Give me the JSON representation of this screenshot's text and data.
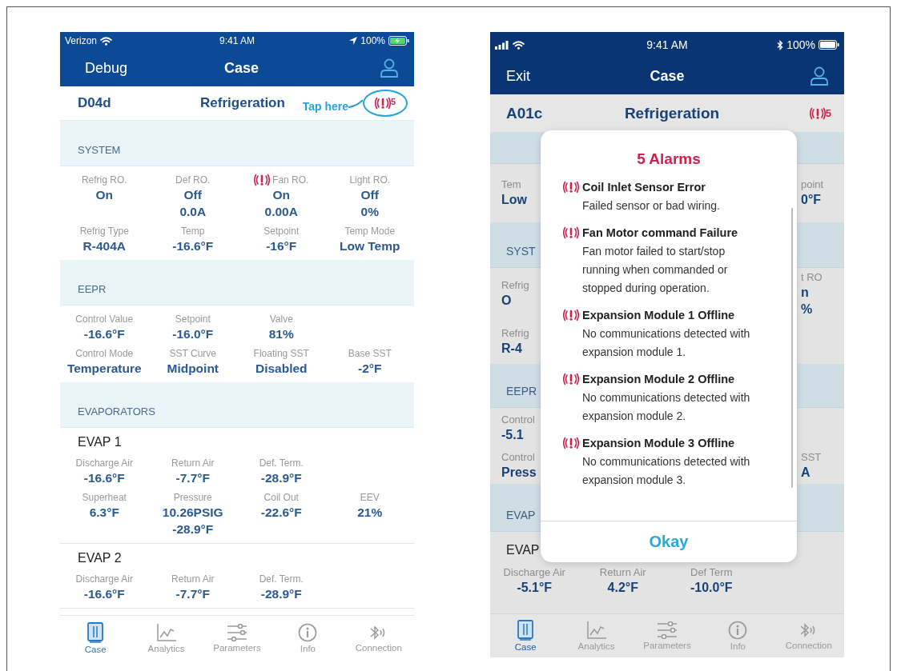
{
  "left_screen": {
    "status_bar": {
      "carrier": "Verizon",
      "time": "9:41 AM",
      "kind": "location",
      "battery": "100%",
      "charging": true
    },
    "nav": {
      "left": "Debug",
      "title": "Case"
    },
    "case_bar": {
      "id": "D04d",
      "title": "Refrigeration",
      "callout": "Tap here",
      "alarm_count": "5"
    },
    "sections": [
      {
        "title": "SYSTEM",
        "groups": [
          {
            "rows": [
              [
                {
                  "label": "Refrig RO.",
                  "values": [
                    "On"
                  ],
                  "alarm": false
                },
                {
                  "label": "Def RO.",
                  "values": [
                    "Off",
                    "0.0A"
                  ],
                  "alarm": false
                },
                {
                  "label": "Fan RO.",
                  "values": [
                    "On",
                    "0.00A"
                  ],
                  "alarm": true
                },
                {
                  "label": "Light RO.",
                  "values": [
                    "Off",
                    "0%"
                  ],
                  "alarm": false
                }
              ],
              [
                {
                  "label": "Refrig Type",
                  "values": [
                    "R-404A"
                  ],
                  "alarm": false
                },
                {
                  "label": "Temp",
                  "values": [
                    "-16.6°F"
                  ],
                  "alarm": false
                },
                {
                  "label": "Setpoint",
                  "values": [
                    "-16°F"
                  ],
                  "alarm": false
                },
                {
                  "label": "Temp Mode",
                  "values": [
                    "Low Temp"
                  ],
                  "alarm": false
                }
              ]
            ]
          }
        ]
      },
      {
        "title": "EEPR",
        "groups": [
          {
            "rows": [
              [
                {
                  "label": "Control Value",
                  "values": [
                    "-16.6°F"
                  ],
                  "alarm": false
                },
                {
                  "label": "Setpoint",
                  "values": [
                    "-16.0°F"
                  ],
                  "alarm": false
                },
                {
                  "label": "Valve",
                  "values": [
                    "81%"
                  ],
                  "alarm": false
                }
              ],
              [
                {
                  "label": "Control Mode",
                  "values": [
                    "Temperature"
                  ],
                  "alarm": false
                },
                {
                  "label": "SST Curve",
                  "values": [
                    "Midpoint"
                  ],
                  "alarm": false
                },
                {
                  "label": "Floating SST",
                  "values": [
                    "Disabled"
                  ],
                  "alarm": false
                },
                {
                  "label": "Base SST",
                  "values": [
                    "-2°F"
                  ],
                  "alarm": false
                }
              ]
            ]
          }
        ]
      },
      {
        "title": "EVAPORATORS",
        "groups": [
          {
            "name": "EVAP 1",
            "rows": [
              [
                {
                  "label": "Discharge Air",
                  "values": [
                    "-16.6°F"
                  ],
                  "alarm": false
                },
                {
                  "label": "Return Air",
                  "values": [
                    "-7.7°F"
                  ],
                  "alarm": false
                },
                {
                  "label": "Def. Term.",
                  "values": [
                    "-28.9°F"
                  ],
                  "alarm": false
                }
              ],
              [
                {
                  "label": "Superheat",
                  "values": [
                    "6.3°F"
                  ],
                  "alarm": false
                },
                {
                  "label": "Pressure",
                  "values": [
                    "10.26PSIG",
                    "-28.9°F"
                  ],
                  "alarm": false
                },
                {
                  "label": "Coil Out",
                  "values": [
                    "-22.6°F"
                  ],
                  "alarm": false
                },
                {
                  "label": "EEV",
                  "values": [
                    "21%"
                  ],
                  "alarm": false
                }
              ]
            ]
          },
          {
            "name": "EVAP 2",
            "rows": [
              [
                {
                  "label": "Discharge Air",
                  "values": [
                    "-16.6°F"
                  ],
                  "alarm": false
                },
                {
                  "label": "Return Air",
                  "values": [
                    "-7.7°F"
                  ],
                  "alarm": false
                },
                {
                  "label": "Def. Term.",
                  "values": [
                    "-28.9°F"
                  ],
                  "alarm": false
                }
              ]
            ]
          }
        ]
      }
    ],
    "tabs": [
      {
        "label": "Case",
        "kind": "case",
        "selected": true
      },
      {
        "label": "Analytics",
        "kind": "analytics",
        "selected": false
      },
      {
        "label": "Parameters",
        "kind": "parameters",
        "selected": false
      },
      {
        "label": "Info",
        "kind": "info",
        "selected": false
      },
      {
        "label": "Connection",
        "kind": "connection",
        "selected": false
      }
    ]
  },
  "right_screen": {
    "status_bar": {
      "time": "9:41 AM",
      "kind": "bluetooth",
      "battery": "100%",
      "charging": false
    },
    "nav": {
      "left": "Exit",
      "title": "Case"
    },
    "case_bar": {
      "id": "A01c",
      "title": "Refrigeration",
      "alarm_count": "5"
    },
    "background_rows": [
      {
        "kind": "section"
      },
      {
        "kind": "field",
        "left": {
          "label": "Tem",
          "values": [
            "Low"
          ]
        },
        "right": {
          "label": "point",
          "values": [
            "0°F"
          ]
        }
      },
      {
        "kind": "section",
        "left_text": "SYST"
      },
      {
        "kind": "field",
        "left": {
          "label": "Refrig",
          "values": [
            "O"
          ]
        },
        "right": {
          "label": "t RO",
          "values": [
            "n",
            "%"
          ]
        }
      },
      {
        "kind": "field",
        "left": {
          "label": "Refrig",
          "values": [
            "R-4"
          ]
        }
      },
      {
        "kind": "section",
        "left_text": "EEPR"
      },
      {
        "kind": "field",
        "left": {
          "label": "Control",
          "values": [
            "-5.1"
          ]
        }
      },
      {
        "kind": "field",
        "left": {
          "label": "Control",
          "values": [
            "Press"
          ]
        },
        "right": {
          "label": "SST",
          "values": [
            "A"
          ]
        }
      },
      {
        "kind": "section",
        "left_text": "EVAP"
      },
      {
        "kind": "group",
        "left_text": "EVAP"
      },
      {
        "kind": "grid",
        "fields": [
          {
            "label": "Discharge Air",
            "values": [
              "-5.1°F"
            ]
          },
          {
            "label": "Return Air",
            "values": [
              "4.2°F"
            ]
          },
          {
            "label": "Def Term",
            "values": [
              "-10.0°F"
            ]
          }
        ]
      }
    ],
    "dialog": {
      "title": "5 Alarms",
      "alarms": [
        {
          "title": "Coil Inlet Sensor Error",
          "description": "Failed sensor or bad wiring."
        },
        {
          "title": "Fan Motor command Failure",
          "description": "Fan motor failed to start/stop running when commanded or stopped during operation."
        },
        {
          "title": "Expansion Module 1 Offline",
          "description": "No communications detected with expansion module 1."
        },
        {
          "title": "Expansion Module 2 Offline",
          "description": "No communications detected with expansion module 2."
        },
        {
          "title": "Expansion Module 3 Offline",
          "description": "No communications detected with expansion module 3."
        }
      ],
      "button": "Okay"
    },
    "tabs": [
      {
        "label": "Case",
        "kind": "case",
        "selected": true
      },
      {
        "label": "Analytics",
        "kind": "analytics",
        "selected": false
      },
      {
        "label": "Parameters",
        "kind": "parameters",
        "selected": false
      },
      {
        "label": "Info",
        "kind": "info",
        "selected": false
      },
      {
        "label": "Connection",
        "kind": "connection",
        "selected": false
      }
    ]
  }
}
